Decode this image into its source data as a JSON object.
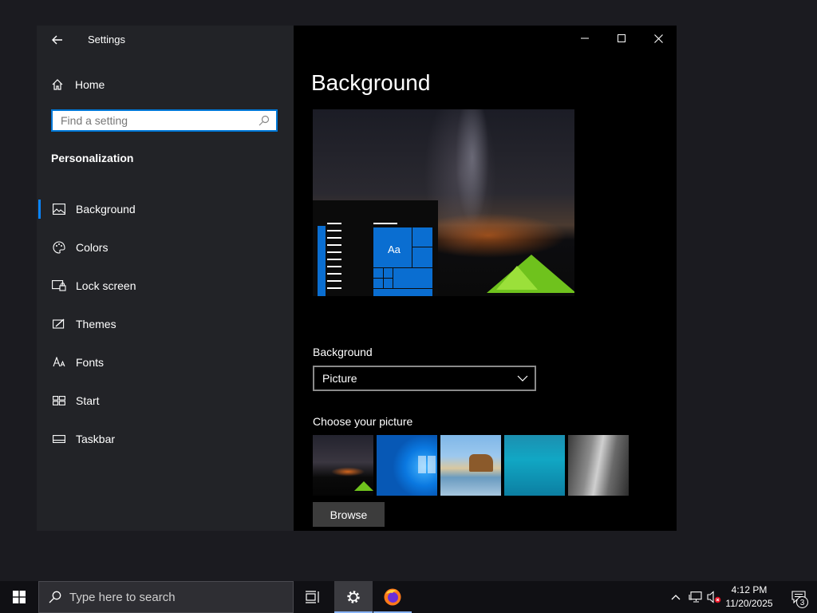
{
  "window": {
    "app_title": "Settings",
    "controls": {
      "minimize": "minimize-icon",
      "maximize": "maximize-icon",
      "close": "close-icon"
    }
  },
  "sidebar": {
    "home_label": "Home",
    "search_placeholder": "Find a setting",
    "section_title": "Personalization",
    "items": [
      {
        "label": "Background",
        "icon": "picture-icon",
        "active": true
      },
      {
        "label": "Colors",
        "icon": "palette-icon"
      },
      {
        "label": "Lock screen",
        "icon": "lock-screen-icon"
      },
      {
        "label": "Themes",
        "icon": "themes-icon"
      },
      {
        "label": "Fonts",
        "icon": "fonts-icon"
      },
      {
        "label": "Start",
        "icon": "start-icon"
      },
      {
        "label": "Taskbar",
        "icon": "taskbar-icon"
      }
    ]
  },
  "main": {
    "title": "Background",
    "preview_tile_label": "Aa",
    "background_field_label": "Background",
    "background_value": "Picture",
    "choose_picture_label": "Choose your picture",
    "thumbnails": [
      "night-sky-tent",
      "windows-blue",
      "beach-rocks",
      "underwater-swimmer",
      "rock-cliff"
    ],
    "browse_label": "Browse"
  },
  "taskbar": {
    "search_placeholder": "Type here to search",
    "time": "4:12 PM",
    "date": "11/20/2025",
    "notification_count": "3",
    "accent_color": "#0a6ed1"
  }
}
